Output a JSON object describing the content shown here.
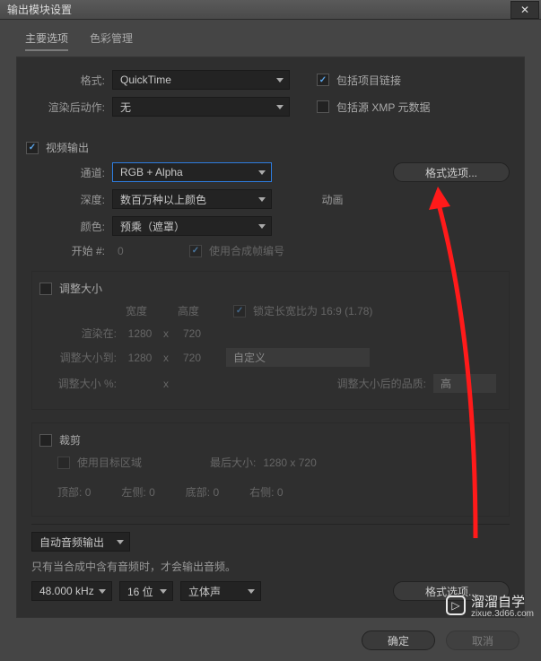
{
  "titlebar": {
    "title": "输出模块设置"
  },
  "tabs": {
    "main": "主要选项",
    "color": "色彩管理"
  },
  "format": {
    "label": "格式:",
    "value": "QuickTime",
    "include_link": "包括项目链接",
    "post_label": "渲染后动作:",
    "post_value": "无",
    "include_xmp": "包括源 XMP 元数据"
  },
  "video": {
    "output": "视频输出",
    "channel_label": "通道:",
    "channel_value": "RGB + Alpha",
    "depth_label": "深度:",
    "depth_value": "数百万种以上颜色",
    "color_label": "颜色:",
    "color_value": "预乘（遮罩）",
    "start_label": "开始 #:",
    "start_value": "0",
    "use_comp_frame": "使用合成帧编号",
    "format_options": "格式选项...",
    "codec": "动画"
  },
  "resize": {
    "title": "调整大小",
    "width": "宽度",
    "height": "高度",
    "lock": "锁定长宽比为",
    "ratio": "16:9 (1.78)",
    "render_at": "渲染在:",
    "rw": "1280",
    "rh": "720",
    "resize_to": "调整大小到:",
    "tw": "1280",
    "th": "720",
    "custom": "自定义",
    "resize_pct": "调整大小 %:",
    "quality_label": "调整大小后的品质:",
    "quality": "高",
    "x": "x"
  },
  "crop": {
    "title": "裁剪",
    "use_roi": "使用目标区域",
    "final_label": "最后大小:",
    "final_value": "1280 x 720",
    "top": "顶部:",
    "left": "左侧:",
    "bottom": "底部:",
    "right": "右侧:",
    "zero": "0"
  },
  "audio": {
    "mode": "自动音频输出",
    "note": "只有当合成中含有音频时，才会输出音频。",
    "rate": "48.000 kHz",
    "bits": "16 位",
    "channels": "立体声",
    "format_options": "格式选项..."
  },
  "footer": {
    "ok": "确定",
    "cancel": "取消"
  },
  "watermark": {
    "name": "溜溜自学",
    "url": "zixue.3d66.com"
  }
}
